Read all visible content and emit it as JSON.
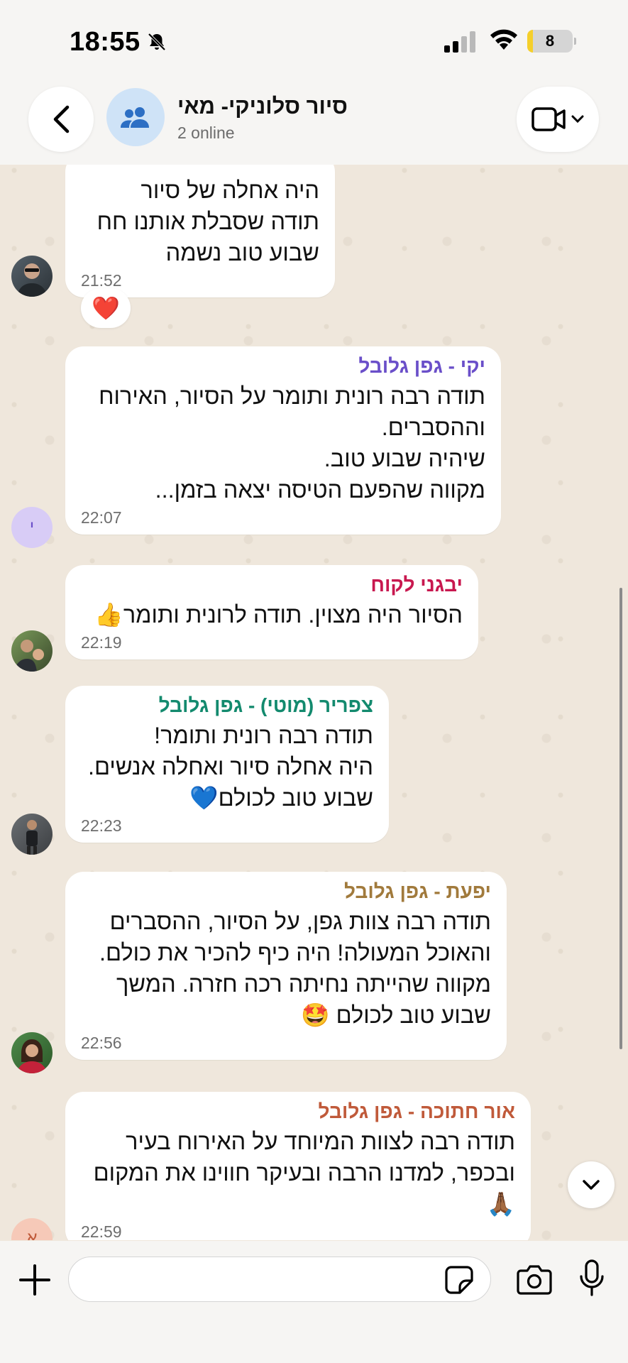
{
  "status_bar": {
    "time": "18:55",
    "battery": "8"
  },
  "header": {
    "title": "סיור סלוניקי- מאי",
    "subtitle": "2 online"
  },
  "messages": [
    {
      "id": "m1",
      "sender": "",
      "sender_color": "#000000",
      "text": "היה אחלה של סיור\nתודה שסבלת אותנו חח\nשבוע טוב נשמה",
      "time": "21:52",
      "reaction": "❤️"
    },
    {
      "id": "m2",
      "sender": "יקי - גפן גלובל",
      "sender_color": "#6a4fc9",
      "text": "תודה רבה רונית ותומר על הסיור, האירוח\nוההסברים.\nשיהיה שבוע טוב.\nמקווה שהפעם הטיסה יצאה בזמן...",
      "time": "22:07",
      "avatar_letter": "י"
    },
    {
      "id": "m3",
      "sender": "יבגני לקוח",
      "sender_color": "#c8184f",
      "text": "הסיור היה מצוין. תודה לרונית ותומר👍",
      "time": "22:19"
    },
    {
      "id": "m4",
      "sender": "צפריר (מוטי) - גפן גלובל",
      "sender_color": "#138a6e",
      "text": "תודה רבה רונית ותומר!\nהיה אחלה סיור ואחלה אנשים.\nשבוע טוב לכולם💙",
      "time": "22:23"
    },
    {
      "id": "m5",
      "sender": "יפעת - גפן גלובל",
      "sender_color": "#a17a3c",
      "text": "תודה רבה צוות גפן, על הסיור, ההסברים\nוהאוכל המעולה! היה כיף להכיר את כולם.\nמקווה שהייתה נחיתה רכה חזרה. המשך\nשבוע טוב לכולם 🤩",
      "time": "22:56"
    },
    {
      "id": "m6",
      "sender": "אור חתוכה - גפן גלובל",
      "sender_color": "#c05a3a",
      "text": "תודה רבה לצוות המיוחד על האירוח בעיר\nובכפר, למדנו הרבה ובעיקר חווינו את המקום\n🙏🏾",
      "time": "22:59",
      "avatar_letter": "א"
    }
  ],
  "input": {
    "placeholder": ""
  }
}
